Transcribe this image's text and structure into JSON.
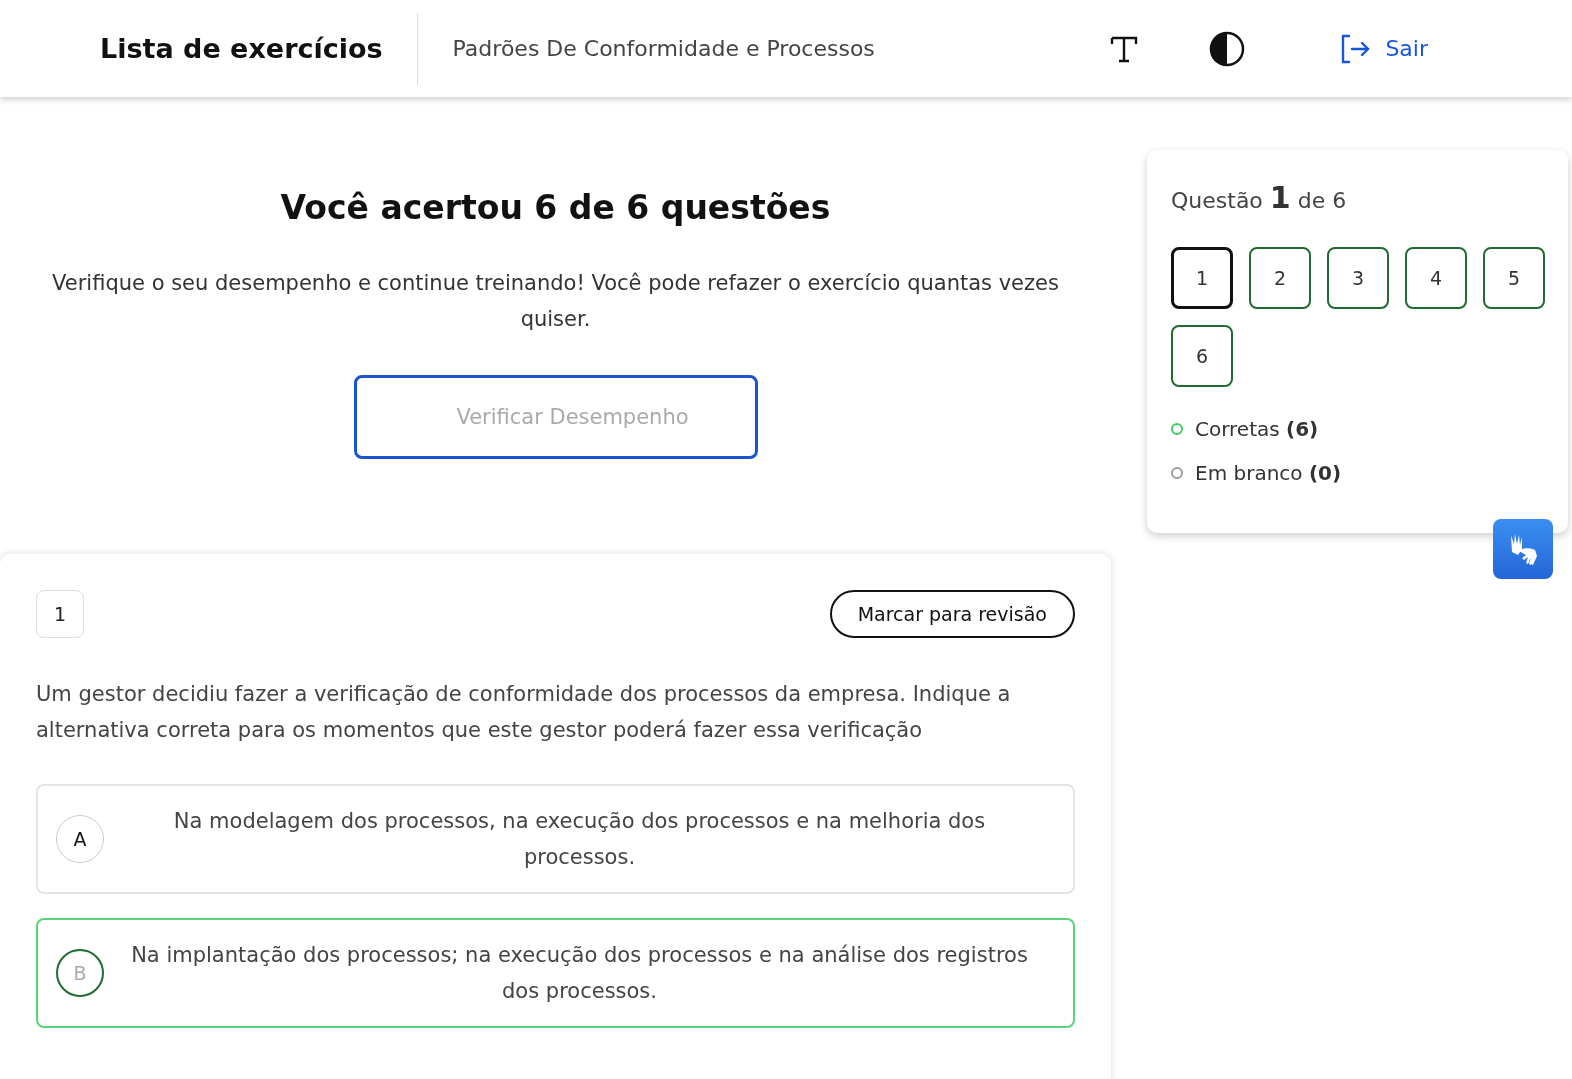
{
  "header": {
    "title": "Lista de exercícios",
    "subtitle": "Padrões De Conformidade e Processos",
    "logout": "Sair"
  },
  "result": {
    "title": "Você acertou 6 de 6 questões",
    "text": "Verifique o seu desempenho e continue treinando! Você pode refazer o exercício quantas vezes quiser.",
    "button": "Verificar Desempenho"
  },
  "question": {
    "number": "1",
    "review_button": "Marcar para revisão",
    "text": "Um gestor decidiu fazer a verificação de conformidade dos processos da empresa. Indique a alternativa correta para os momentos que este gestor poderá fazer essa verificação",
    "options": [
      {
        "letter": "A",
        "text": "Na modelagem dos processos, na execução dos processos e na melhoria dos processos.",
        "correct": false
      },
      {
        "letter": "B",
        "text": "Na implantação dos processos; na execução dos processos e na análise dos registros dos processos.",
        "correct": true
      }
    ]
  },
  "navigator": {
    "prefix": "Questão",
    "current": "1",
    "suffix": "de 6",
    "items": [
      {
        "label": "1",
        "selected": true,
        "correct": true
      },
      {
        "label": "2",
        "selected": false,
        "correct": true
      },
      {
        "label": "3",
        "selected": false,
        "correct": true
      },
      {
        "label": "4",
        "selected": false,
        "correct": true
      },
      {
        "label": "5",
        "selected": false,
        "correct": true
      },
      {
        "label": "6",
        "selected": false,
        "correct": true
      }
    ],
    "legend": [
      {
        "label": "Corretas",
        "count": "(6)",
        "color": "#3ecf5e"
      },
      {
        "label": "Em branco",
        "count": "(0)",
        "color": "#9e9e9e"
      }
    ]
  }
}
